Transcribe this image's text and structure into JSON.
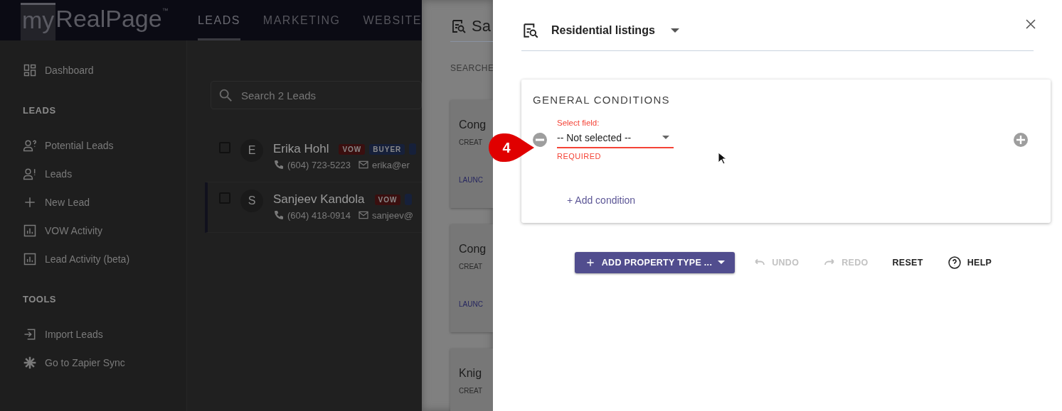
{
  "app": {
    "logo": {
      "prefix": "my",
      "name": "RealPage",
      "mark": "™"
    },
    "nav_tabs": [
      {
        "label": "LEADS",
        "selected": true
      },
      {
        "label": "MARKETING",
        "selected": false
      },
      {
        "label": "WEBSITE",
        "selected": false
      }
    ],
    "sidebar": {
      "sections": [
        {
          "items": [
            {
              "label": "Dashboard"
            }
          ]
        },
        {
          "title": "LEADS",
          "items": [
            {
              "label": "Potential Leads"
            },
            {
              "label": "Leads"
            },
            {
              "label": "New Lead"
            },
            {
              "label": "VOW Activity"
            },
            {
              "label": "Lead Activity (beta)"
            }
          ]
        },
        {
          "title": "TOOLS",
          "items": [
            {
              "label": "Import Leads"
            },
            {
              "label": "Go to Zapier Sync"
            }
          ]
        }
      ]
    },
    "search": {
      "placeholder": "Search 2 Leads"
    },
    "leads": [
      {
        "initial": "E",
        "name": "Erika Hohl",
        "selected": false,
        "checked": false,
        "tags": [
          {
            "label": "VOW",
            "color": "#3a0f0f"
          },
          {
            "label": "BUYER",
            "color": "#16203a"
          },
          {
            "color": "#16203a"
          }
        ],
        "phone": "(604) 723-5223",
        "email": "erika@er"
      },
      {
        "initial": "S",
        "name": "Sanjeev Kandola",
        "selected": true,
        "checked": false,
        "tags": [
          {
            "label": "VOW",
            "color": "#3a0f0f"
          },
          {
            "color": "#16203a"
          }
        ],
        "phone": "(604) 418-0914",
        "email": "sanjeev@"
      }
    ]
  },
  "saved_searches": {
    "title": "Sa",
    "subtitle": "SEARCHE",
    "cards": [
      {
        "title": "Cong",
        "meta": "CREAT",
        "action": "LAUNC"
      },
      {
        "title": "Cong",
        "meta": "CREAT",
        "action": "LAUNC"
      },
      {
        "title": "Knig",
        "meta": "CREAT"
      }
    ]
  },
  "drawer": {
    "title": "Residential listings",
    "section": {
      "title": "GENERAL CONDITIONS",
      "conditions": [
        {
          "label": "Select field:",
          "value": "-- Not selected --",
          "error": "REQUIRED"
        }
      ],
      "add_label": "+ Add condition"
    },
    "toolbar": [
      {
        "label": "ADD PROPERTY TYPE ...",
        "kind": "primary",
        "disabled": false
      },
      {
        "label": "UNDO",
        "kind": "undo",
        "disabled": true
      },
      {
        "label": "REDO",
        "kind": "redo",
        "disabled": true
      },
      {
        "label": "RESET",
        "kind": "text",
        "disabled": false
      },
      {
        "label": "HELP",
        "kind": "help",
        "disabled": false
      }
    ]
  },
  "callout": {
    "label": "4"
  }
}
